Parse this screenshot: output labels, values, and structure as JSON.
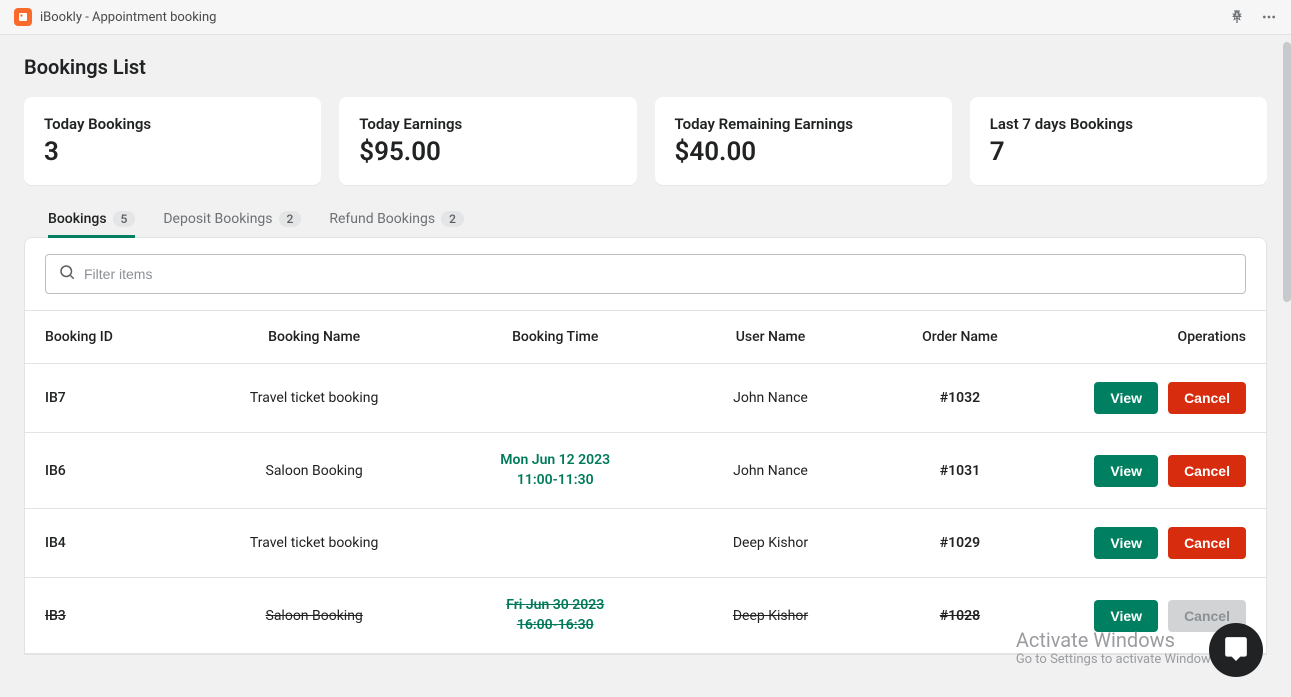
{
  "titlebar": {
    "title": "iBookly - Appointment booking"
  },
  "page": {
    "title": "Bookings List"
  },
  "cards": [
    {
      "label": "Today Bookings",
      "value": "3"
    },
    {
      "label": "Today Earnings",
      "value": "$95.00"
    },
    {
      "label": "Today Remaining Earnings",
      "value": "$40.00"
    },
    {
      "label": "Last 7 days Bookings",
      "value": "7"
    }
  ],
  "tabs": [
    {
      "label": "Bookings",
      "count": "5",
      "active": true
    },
    {
      "label": "Deposit Bookings",
      "count": "2",
      "active": false
    },
    {
      "label": "Refund Bookings",
      "count": "2",
      "active": false
    }
  ],
  "search": {
    "placeholder": "Filter items"
  },
  "table": {
    "headers": {
      "id": "Booking ID",
      "name": "Booking Name",
      "time": "Booking Time",
      "user": "User Name",
      "order": "Order Name",
      "ops": "Operations"
    },
    "rows": [
      {
        "id": "IB7",
        "name": "Travel ticket booking",
        "time_line1": "",
        "time_line2": "",
        "user": "John Nance",
        "order": "#1032",
        "cancelled": false
      },
      {
        "id": "IB6",
        "name": "Saloon Booking",
        "time_line1": "Mon Jun 12 2023",
        "time_line2": "11:00-11:30",
        "user": "John Nance",
        "order": "#1031",
        "cancelled": false
      },
      {
        "id": "IB4",
        "name": "Travel ticket booking",
        "time_line1": "",
        "time_line2": "",
        "user": "Deep Kishor",
        "order": "#1029",
        "cancelled": false
      },
      {
        "id": "IB3",
        "name": "Saloon Booking",
        "time_line1": "Fri Jun 30 2023",
        "time_line2": "16:00-16:30",
        "user": "Deep Kishor",
        "order": "#1028",
        "cancelled": true
      }
    ]
  },
  "buttons": {
    "view": "View",
    "cancel": "Cancel"
  },
  "watermark": {
    "title": "Activate Windows",
    "sub": "Go to Settings to activate Windows."
  }
}
